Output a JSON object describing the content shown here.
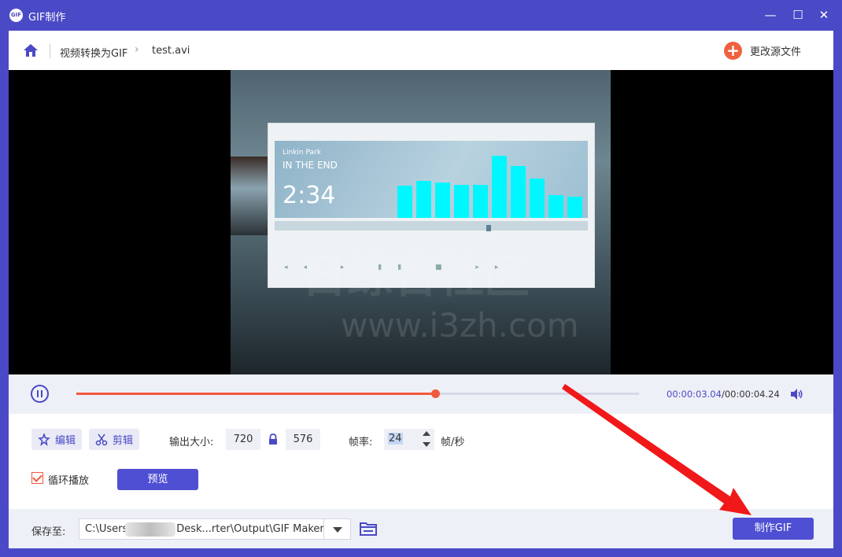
{
  "window": {
    "title": "GIF制作",
    "logo_text": "GIF",
    "controls": {
      "minimize": "—",
      "maximize": "☐",
      "close": "✕"
    }
  },
  "breadcrumb": {
    "home_icon": "home-icon",
    "items": [
      "视频转换为GIF",
      "test.avi"
    ],
    "separator": "›"
  },
  "header": {
    "change_source_label": "更改源文件",
    "change_source_icon": "plus-icon"
  },
  "video_frame": {
    "artist": "Linkin Park",
    "song": "IN THE END",
    "time": "2:34",
    "transport": "◂◂ ▸ ▮▮ ■ ▸▸",
    "watermark_line1": "日综合社区",
    "watermark_line2": "www.i3zh.com",
    "eq_levels": [
      0.45,
      0.52,
      0.5,
      0.47,
      0.47,
      0.88,
      0.73,
      0.55,
      0.32,
      0.3
    ]
  },
  "playback": {
    "state": "playing",
    "current": "00:00:03.04",
    "total": "/00:00:04.24",
    "progress": 0.638
  },
  "edit": {
    "edit_label": "编辑",
    "cut_label": "剪辑",
    "output_size_label": "输出大小:",
    "width": "720",
    "height": "576",
    "fps_label": "帧率:",
    "fps_value": "24",
    "fps_unit": "帧/秒",
    "loop_label": "循环播放",
    "loop_checked": true,
    "preview_label": "预览"
  },
  "save": {
    "label": "保存至:",
    "path": "C:\\Users               Desk...rter\\Output\\GIF Maker",
    "make_label": "制作GIF"
  },
  "colors": {
    "accent": "#4a49c6",
    "orange": "#f05a3c",
    "eq": "#00f7ff",
    "arrow": "#f01818"
  }
}
